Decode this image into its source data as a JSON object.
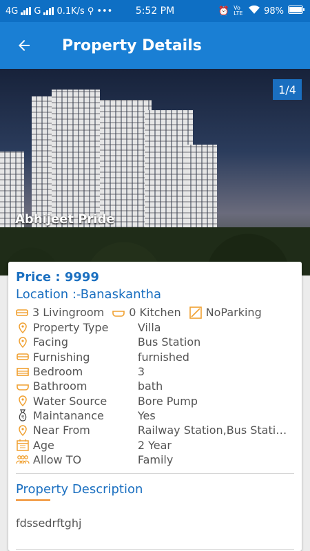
{
  "status_bar": {
    "network1": "4G",
    "network2": "G",
    "speed": "0.1K/s",
    "time": "5:52 PM",
    "volte": "Vo LTE",
    "battery": "98%"
  },
  "app_bar": {
    "title": "Property Details"
  },
  "gallery": {
    "counter": "1/4",
    "property_name": "Abhijeet Pride"
  },
  "details": {
    "price": "Price : 9999",
    "location": "Location :-Banaskantha",
    "amenities": [
      {
        "icon": "sofa-icon",
        "label": "3 Livingroom"
      },
      {
        "icon": "bathtub-icon",
        "label": "0 Kitchen"
      },
      {
        "icon": "parking-icon",
        "label": "NoParking"
      }
    ],
    "rows": [
      {
        "icon": "location-pin-icon",
        "label": "Property Type",
        "value": "Villa"
      },
      {
        "icon": "location-pin-icon",
        "label": "Facing",
        "value": "Bus Station"
      },
      {
        "icon": "sofa-icon",
        "label": "Furnishing",
        "value": "furnished"
      },
      {
        "icon": "bed-icon",
        "label": "Bedroom",
        "value": "3"
      },
      {
        "icon": "bathtub-icon",
        "label": "Bathroom",
        "value": "bath"
      },
      {
        "icon": "location-pin-icon",
        "label": "Water Source",
        "value": "Bore Pump"
      },
      {
        "icon": "money-bag-icon",
        "label": "Maintanance",
        "value": "Yes"
      },
      {
        "icon": "location-pin-icon",
        "label": "Near From",
        "value": "Railway Station,Bus Station,Sch"
      },
      {
        "icon": "calendar-icon",
        "label": "Age",
        "value": "2 Year"
      },
      {
        "icon": "people-icon",
        "label": "Allow TO",
        "value": "Family"
      }
    ],
    "description_title": "Property Description",
    "description": "fdssedrftghj"
  },
  "colors": {
    "primary": "#1a7fd4",
    "status": "#0e6fc4",
    "accent": "#f08a24",
    "text": "#555555"
  }
}
